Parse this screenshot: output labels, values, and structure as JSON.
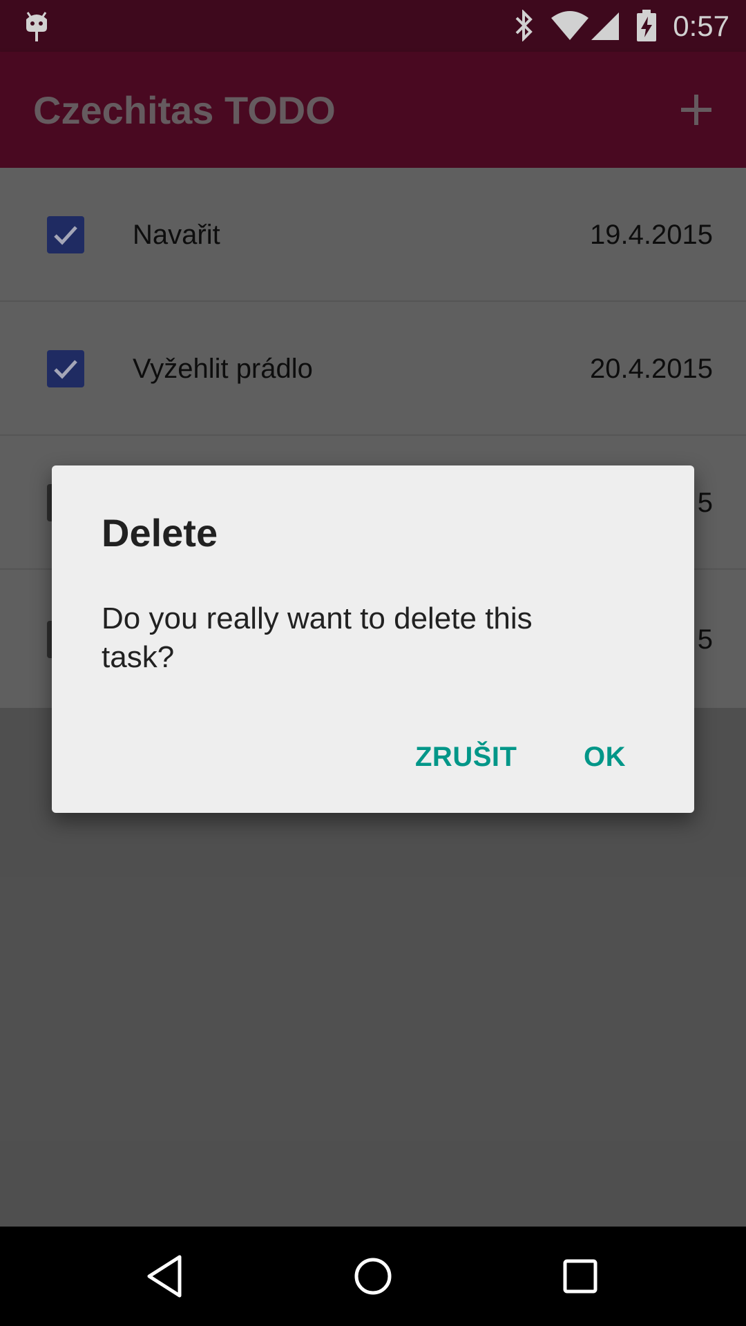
{
  "status_bar": {
    "time": "0:57",
    "icons": [
      "android-debug-icon",
      "bluetooth-icon",
      "wifi-icon",
      "cell-signal-icon",
      "battery-charging-icon"
    ]
  },
  "app_bar": {
    "title": "Czechitas TODO",
    "action_icon": "add-icon"
  },
  "tasks": [
    {
      "name": "Navařit",
      "date": "19.4.2015",
      "done": true
    },
    {
      "name": "Vyžehlit prádlo",
      "date": "20.4.2015",
      "done": true
    },
    {
      "name": "",
      "date": "5",
      "done": false
    },
    {
      "name": "",
      "date": "5",
      "done": false
    }
  ],
  "dialog": {
    "title": "Delete",
    "message": "Do you really want to delete this task?",
    "cancel_label": "ZRUŠIT",
    "ok_label": "OK"
  },
  "nav_bar": {
    "icons": [
      "back-icon",
      "home-icon",
      "recent-apps-icon"
    ]
  },
  "colors": {
    "status_bar": "#4c0c24",
    "app_bar": "#5a0c29",
    "scrim_background": "#616161",
    "dialog_background": "#eeeeee",
    "dialog_button": "#009688",
    "checkbox_checked": "#263578"
  }
}
